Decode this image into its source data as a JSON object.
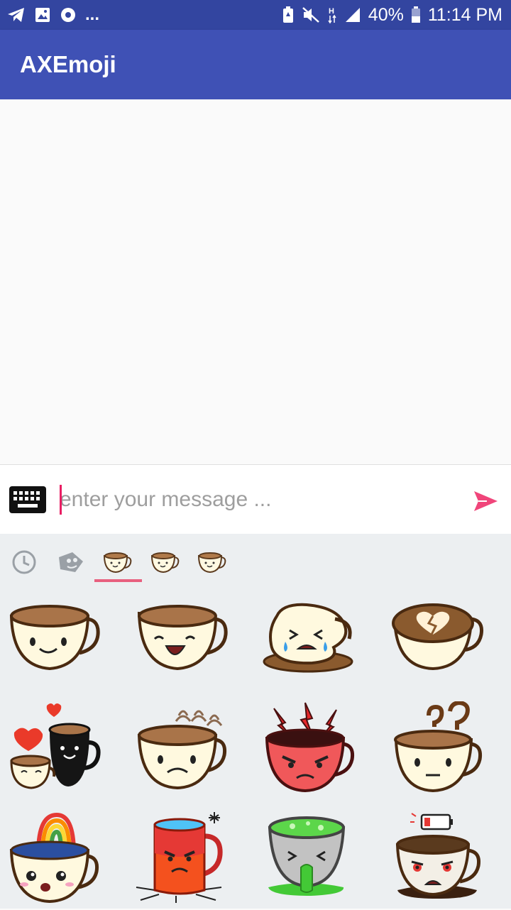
{
  "status_bar": {
    "battery": "40%",
    "time": "11:14 PM",
    "icons": [
      "telegram-icon",
      "gallery-icon",
      "sync-icon",
      "more-notifications-icon",
      "battery-saver-icon",
      "mute-icon",
      "hspa-icon",
      "signal-icon",
      "battery-icon"
    ]
  },
  "app_bar": {
    "title": "AXEmoji"
  },
  "input": {
    "placeholder": "enter your message ...",
    "value": ""
  },
  "picker": {
    "selected_tab_index": 2,
    "tabs": [
      "recent-clock-icon",
      "sticker-face-icon",
      "coffee-cup-icon",
      "coffee-cup-icon",
      "coffee-cup-icon"
    ],
    "stickers": [
      "happy-coffee-cup",
      "laughing-coffee-cup",
      "crying-spilled-cup",
      "broken-heart-latte",
      "coffee-cups-in-love",
      "sad-steaming-cup",
      "angry-red-cup",
      "confused-cup",
      "rainbow-cup",
      "angry-red-mug",
      "sick-green-cup",
      "low-battery-tired-cup"
    ]
  },
  "colors": {
    "status_bar": "#3345a0",
    "app_bar": "#3f51b5",
    "accent": "#e91e63",
    "send": "#f0457a",
    "picker_bg": "#eceff1"
  }
}
